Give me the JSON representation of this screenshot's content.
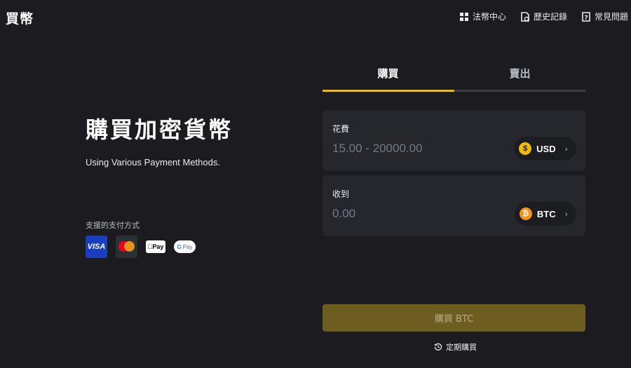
{
  "header": {
    "brand": "買幣",
    "nav": [
      {
        "label": "法幣中心",
        "icon": "grid-icon"
      },
      {
        "label": "歷史記錄",
        "icon": "history-document-icon"
      },
      {
        "label": "常見問題",
        "icon": "faq-icon"
      }
    ]
  },
  "hero": {
    "title": "購買加密貨幣",
    "subtitle": "Using Various Payment Methods.",
    "payment_label": "支援的支付方式",
    "payment_methods": [
      {
        "name": "VISA",
        "icon": "visa-icon"
      },
      {
        "name": "Mastercard",
        "icon": "mastercard-icon"
      },
      {
        "name": "Pay",
        "icon": "apple-pay-icon"
      },
      {
        "name": "Pay",
        "icon": "google-pay-icon"
      }
    ]
  },
  "trade": {
    "tabs": [
      {
        "label": "購買",
        "active": true
      },
      {
        "label": "賣出",
        "active": false
      }
    ],
    "spend": {
      "label": "花費",
      "placeholder": "15.00 - 20000.00",
      "currency": "USD",
      "currency_icon": "usd-coin-icon"
    },
    "receive": {
      "label": "收到",
      "placeholder": "0.00",
      "currency": "BTC",
      "currency_icon": "btc-coin-icon"
    },
    "buy_button": "購買 BTC",
    "recurring": "定期購買"
  },
  "colors": {
    "background": "#1c1c20",
    "panel": "#26272c",
    "accent": "#f0b90b",
    "button_disabled": "#6e5d20"
  }
}
